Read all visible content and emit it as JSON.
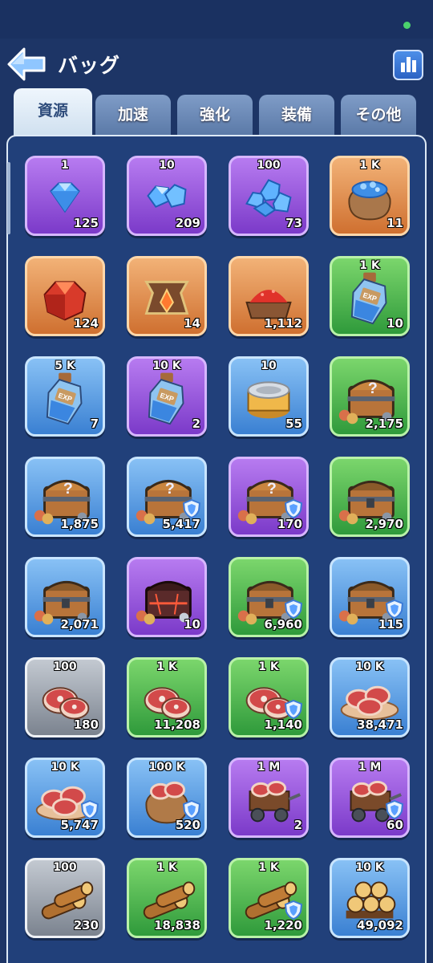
{
  "header": {
    "title": "バッグ"
  },
  "tabs": [
    {
      "label": "資源",
      "active": true
    },
    {
      "label": "加速",
      "active": false
    },
    {
      "label": "強化",
      "active": false
    },
    {
      "label": "装備",
      "active": false
    },
    {
      "label": "その他",
      "active": false
    }
  ],
  "items": [
    {
      "icon": "gem-icon",
      "rarity": "purple",
      "amount": "1",
      "count": "125",
      "shield": false
    },
    {
      "icon": "gems-pile-icon",
      "rarity": "purple",
      "amount": "10",
      "count": "209",
      "shield": false
    },
    {
      "icon": "gems-cluster-icon",
      "rarity": "purple",
      "amount": "100",
      "count": "73",
      "shield": false
    },
    {
      "icon": "gem-sack-icon",
      "rarity": "orange",
      "amount": "1 K",
      "count": "11",
      "shield": false
    },
    {
      "icon": "red-crystal-icon",
      "rarity": "orange",
      "amount": "",
      "count": "124",
      "shield": false
    },
    {
      "icon": "crest-emblem-icon",
      "rarity": "orange",
      "amount": "",
      "count": "14",
      "shield": false
    },
    {
      "icon": "red-powder-cart-icon",
      "rarity": "orange",
      "amount": "",
      "count": "1,112",
      "shield": false
    },
    {
      "icon": "exp-potion-icon",
      "rarity": "green",
      "amount": "1 K",
      "count": "10",
      "shield": false
    },
    {
      "icon": "exp-potion-icon",
      "rarity": "blue",
      "amount": "5 K",
      "count": "7",
      "shield": false
    },
    {
      "icon": "exp-potion-icon",
      "rarity": "purple",
      "amount": "10 K",
      "count": "2",
      "shield": false
    },
    {
      "icon": "tin-can-icon",
      "rarity": "blue",
      "amount": "10",
      "count": "55",
      "shield": false
    },
    {
      "icon": "mystery-chest-icon",
      "rarity": "green",
      "amount": "",
      "count": "2,175",
      "shield": false
    },
    {
      "icon": "mystery-chest-icon",
      "rarity": "blue",
      "amount": "",
      "count": "1,875",
      "shield": false
    },
    {
      "icon": "mystery-chest-icon",
      "rarity": "blue",
      "amount": "",
      "count": "5,417",
      "shield": true
    },
    {
      "icon": "mystery-chest-icon",
      "rarity": "purple",
      "amount": "",
      "count": "170",
      "shield": true
    },
    {
      "icon": "resource-chest-icon",
      "rarity": "green",
      "amount": "",
      "count": "2,970",
      "shield": false
    },
    {
      "icon": "resource-chest-icon",
      "rarity": "blue",
      "amount": "",
      "count": "2,071",
      "shield": false
    },
    {
      "icon": "dark-chest-icon",
      "rarity": "purple",
      "amount": "",
      "count": "10",
      "shield": false
    },
    {
      "icon": "resource-chest-icon",
      "rarity": "green",
      "amount": "",
      "count": "6,960",
      "shield": true
    },
    {
      "icon": "resource-chest-icon",
      "rarity": "blue",
      "amount": "",
      "count": "115",
      "shield": true
    },
    {
      "icon": "meat-icon",
      "rarity": "gray",
      "amount": "100",
      "count": "180",
      "shield": false
    },
    {
      "icon": "meat-icon",
      "rarity": "green",
      "amount": "1 K",
      "count": "11,208",
      "shield": false
    },
    {
      "icon": "meat-icon",
      "rarity": "green",
      "amount": "1 K",
      "count": "1,140",
      "shield": true
    },
    {
      "icon": "meat-platter-icon",
      "rarity": "blue",
      "amount": "10 K",
      "count": "38,471",
      "shield": false
    },
    {
      "icon": "meat-platter-icon",
      "rarity": "blue",
      "amount": "10 K",
      "count": "5,747",
      "shield": true
    },
    {
      "icon": "meat-sack-icon",
      "rarity": "blue",
      "amount": "100 K",
      "count": "520",
      "shield": true
    },
    {
      "icon": "meat-cart-icon",
      "rarity": "purple",
      "amount": "1 M",
      "count": "2",
      "shield": false
    },
    {
      "icon": "meat-cart-icon",
      "rarity": "purple",
      "amount": "1 M",
      "count": "60",
      "shield": true
    },
    {
      "icon": "wood-logs-icon",
      "rarity": "gray",
      "amount": "100",
      "count": "230",
      "shield": false
    },
    {
      "icon": "wood-logs-icon",
      "rarity": "green",
      "amount": "1 K",
      "count": "18,838",
      "shield": false
    },
    {
      "icon": "wood-logs-icon",
      "rarity": "green",
      "amount": "1 K",
      "count": "1,220",
      "shield": true
    },
    {
      "icon": "wood-pile-icon",
      "rarity": "blue",
      "amount": "10 K",
      "count": "49,092",
      "shield": false
    }
  ],
  "colors": {
    "background": "#1d3566",
    "panel": "#21407a",
    "accent": "#4d8fe8"
  }
}
